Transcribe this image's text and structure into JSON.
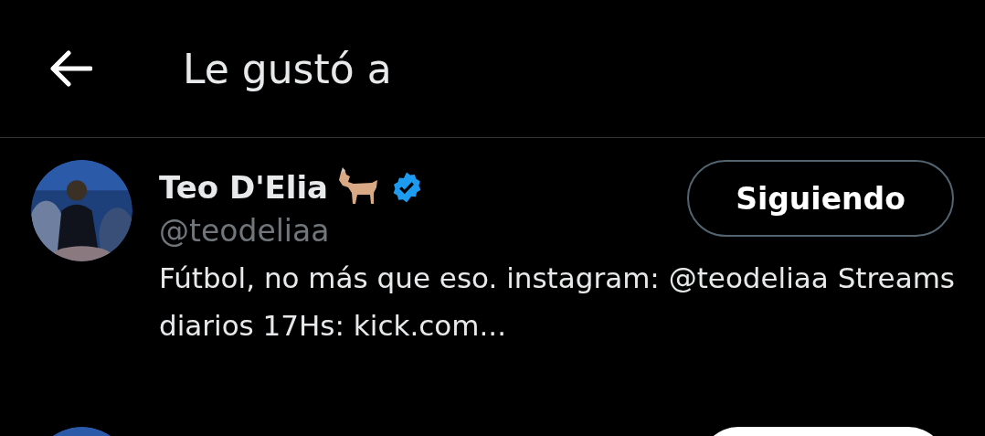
{
  "header": {
    "title": "Le gustó a"
  },
  "users": [
    {
      "name": "Teo D'Elia",
      "verified": true,
      "handle": "@teodeliaa",
      "bio": "Fútbol, no más que eso. instagram: @teodeliaa Streams diarios 17Hs: kick.com...",
      "button": "Siguiendo",
      "following": true
    },
    {
      "following": false
    }
  ]
}
